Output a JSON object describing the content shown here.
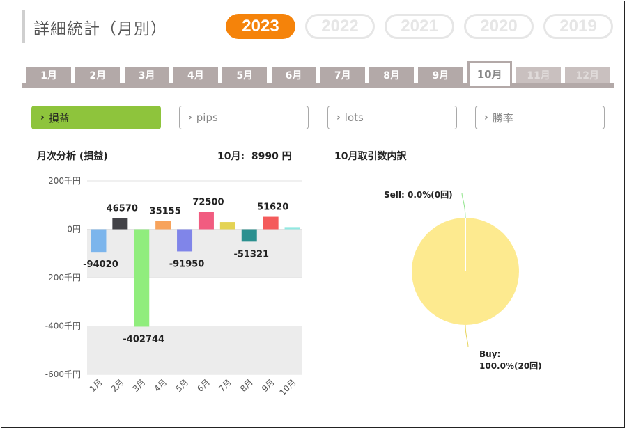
{
  "header": {
    "title": "詳細統計（月別）",
    "years": [
      {
        "label": "2023",
        "active": true
      },
      {
        "label": "2022",
        "active": false
      },
      {
        "label": "2021",
        "active": false
      },
      {
        "label": "2020",
        "active": false
      },
      {
        "label": "2019",
        "active": false
      }
    ]
  },
  "months": [
    {
      "label": "1月",
      "state": "normal"
    },
    {
      "label": "2月",
      "state": "normal"
    },
    {
      "label": "3月",
      "state": "normal"
    },
    {
      "label": "4月",
      "state": "normal"
    },
    {
      "label": "5月",
      "state": "normal"
    },
    {
      "label": "6月",
      "state": "normal"
    },
    {
      "label": "7月",
      "state": "normal"
    },
    {
      "label": "8月",
      "state": "normal"
    },
    {
      "label": "9月",
      "state": "normal"
    },
    {
      "label": "10月",
      "state": "active"
    },
    {
      "label": "11月",
      "state": "disabled"
    },
    {
      "label": "12月",
      "state": "disabled"
    }
  ],
  "metrics": [
    {
      "label": "損益",
      "active": true
    },
    {
      "label": "pips",
      "active": false
    },
    {
      "label": "lots",
      "active": false
    },
    {
      "label": "勝率",
      "active": false
    }
  ],
  "monthly": {
    "heading": "月次分析 (損益)",
    "total_label": "10月:",
    "total_value": "8990 円"
  },
  "breakdown": {
    "heading": "10月取引数内訳"
  },
  "colors": {
    "accent": "#f5830a",
    "metric_active": "#8ec43c",
    "tab": "#b3a9a8",
    "band": "#ececec"
  },
  "chart_data": [
    {
      "type": "bar",
      "categories": [
        "1月",
        "2月",
        "3月",
        "4月",
        "5月",
        "6月",
        "7月",
        "8月",
        "9月",
        "10月"
      ],
      "values": [
        -94020,
        46570,
        -402744,
        35155,
        -91950,
        72500,
        30000,
        -51321,
        51620,
        8990
      ],
      "value_labels": [
        "-94020",
        "46570",
        "-402744",
        "35155",
        "-91950",
        "72500",
        "",
        "-51321",
        "51620",
        ""
      ],
      "colors": [
        "#7cb5ec",
        "#434348",
        "#90ed7d",
        "#f7a35c",
        "#8085e9",
        "#f15c80",
        "#e4d354",
        "#2b908f",
        "#f45b5b",
        "#91e8e1"
      ],
      "ylim": [
        -600000,
        200000
      ],
      "yticks": [
        {
          "value": 200000,
          "label": "200千円"
        },
        {
          "value": 0,
          "label": "0円"
        },
        {
          "value": -200000,
          "label": "-200千円"
        },
        {
          "value": -400000,
          "label": "-400千円"
        },
        {
          "value": -600000,
          "label": "-600千円"
        }
      ],
      "grid": true
    },
    {
      "type": "pie",
      "slices": [
        {
          "name": "Sell",
          "value": 0,
          "label_lines": [
            "Sell: 0.0%(0回)"
          ],
          "color": "#f7a35c"
        },
        {
          "name": "Buy",
          "value": 100,
          "label_lines": [
            "Buy:",
            "100.0%(20回)"
          ],
          "color": "#fdea8f"
        }
      ]
    }
  ]
}
